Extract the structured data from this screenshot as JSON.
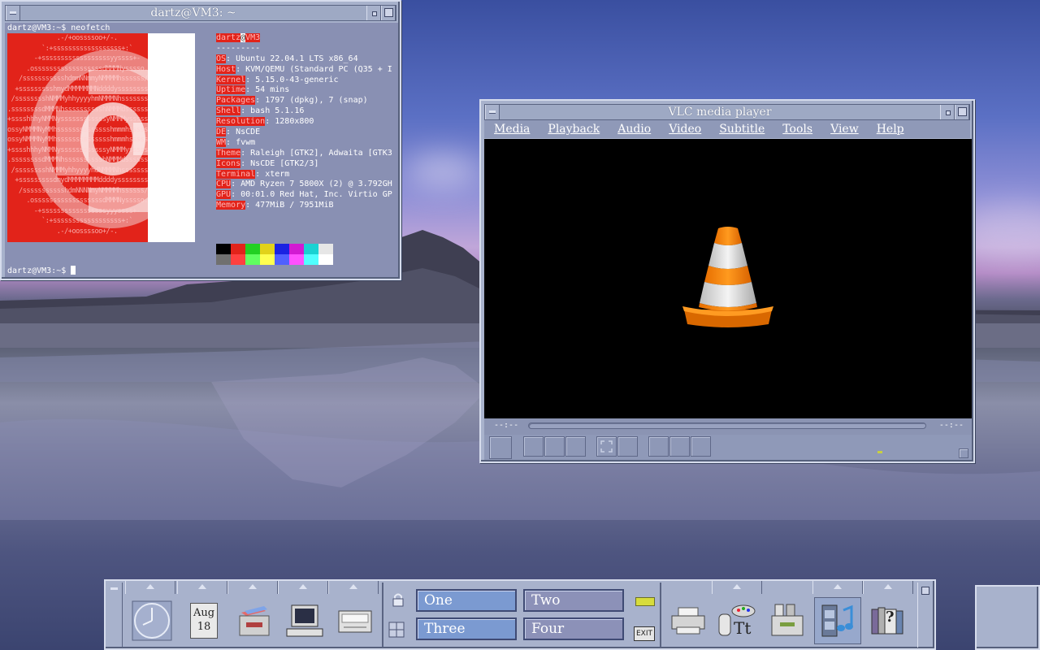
{
  "terminal": {
    "title": "dartz@VM3: ~",
    "prompt_line": "dartz@VM3:~$ neofetch",
    "prompt_end": "dartz@VM3:~$ ",
    "user": "dartz",
    "at": "@",
    "host": "VM3",
    "separator": "---------",
    "info": [
      {
        "key": "OS",
        "value": ": Ubuntu 22.04.1 LTS x86_64"
      },
      {
        "key": "Host",
        "value": ": KVM/QEMU (Standard PC (Q35 + I"
      },
      {
        "key": "Kernel",
        "value": ": 5.15.0-43-generic"
      },
      {
        "key": "Uptime",
        "value": ": 54 mins"
      },
      {
        "key": "Packages",
        "value": ": 1797 (dpkg), 7 (snap)"
      },
      {
        "key": "Shell",
        "value": ": bash 5.1.16"
      },
      {
        "key": "Resolution",
        "value": ": 1280x800"
      },
      {
        "key": "DE",
        "value": ": NsCDE"
      },
      {
        "key": "WM",
        "value": ": fvwm"
      },
      {
        "key": "Theme",
        "value": ": Raleigh [GTK2], Adwaita [GTK3"
      },
      {
        "key": "Icons",
        "value": ": NsCDE [GTK2/3]"
      },
      {
        "key": "Terminal",
        "value": ": xterm"
      },
      {
        "key": "CPU",
        "value": ": AMD Ryzen 7 5800X (2) @ 3.792GH"
      },
      {
        "key": "GPU",
        "value": ": 00:01.0 Red Hat, Inc. Virtio GP"
      },
      {
        "key": "Memory",
        "value": ": 477MiB / 7951MiB"
      }
    ],
    "swatch_colors_top": [
      "#000000",
      "#e2231a",
      "#22d022",
      "#e2d21a",
      "#1a22e2",
      "#d21ad2",
      "#1ad2d2",
      "#e6e6e6"
    ],
    "swatch_colors_bottom": [
      "#707070",
      "#ff4040",
      "#60ff60",
      "#ffff50",
      "#5060ff",
      "#ff50ff",
      "#50ffff",
      "#ffffff"
    ]
  },
  "vlc": {
    "title": "VLC media player",
    "menu": [
      {
        "label": "Media"
      },
      {
        "label": "Playback"
      },
      {
        "label": "Audio"
      },
      {
        "label": "Video"
      },
      {
        "label": "Subtitle"
      },
      {
        "label": "Tools"
      },
      {
        "label": "View"
      },
      {
        "label": "Help"
      }
    ],
    "elapsed": "--:--",
    "remaining": "--:--"
  },
  "panel": {
    "date_month": "Aug",
    "date_day": "18",
    "workspaces": [
      {
        "label": "One",
        "active": true
      },
      {
        "label": "Two",
        "active": false
      },
      {
        "label": "Three",
        "active": true
      },
      {
        "label": "Four",
        "active": false
      }
    ],
    "exit_label": "EXIT",
    "help_glyph": "?"
  }
}
